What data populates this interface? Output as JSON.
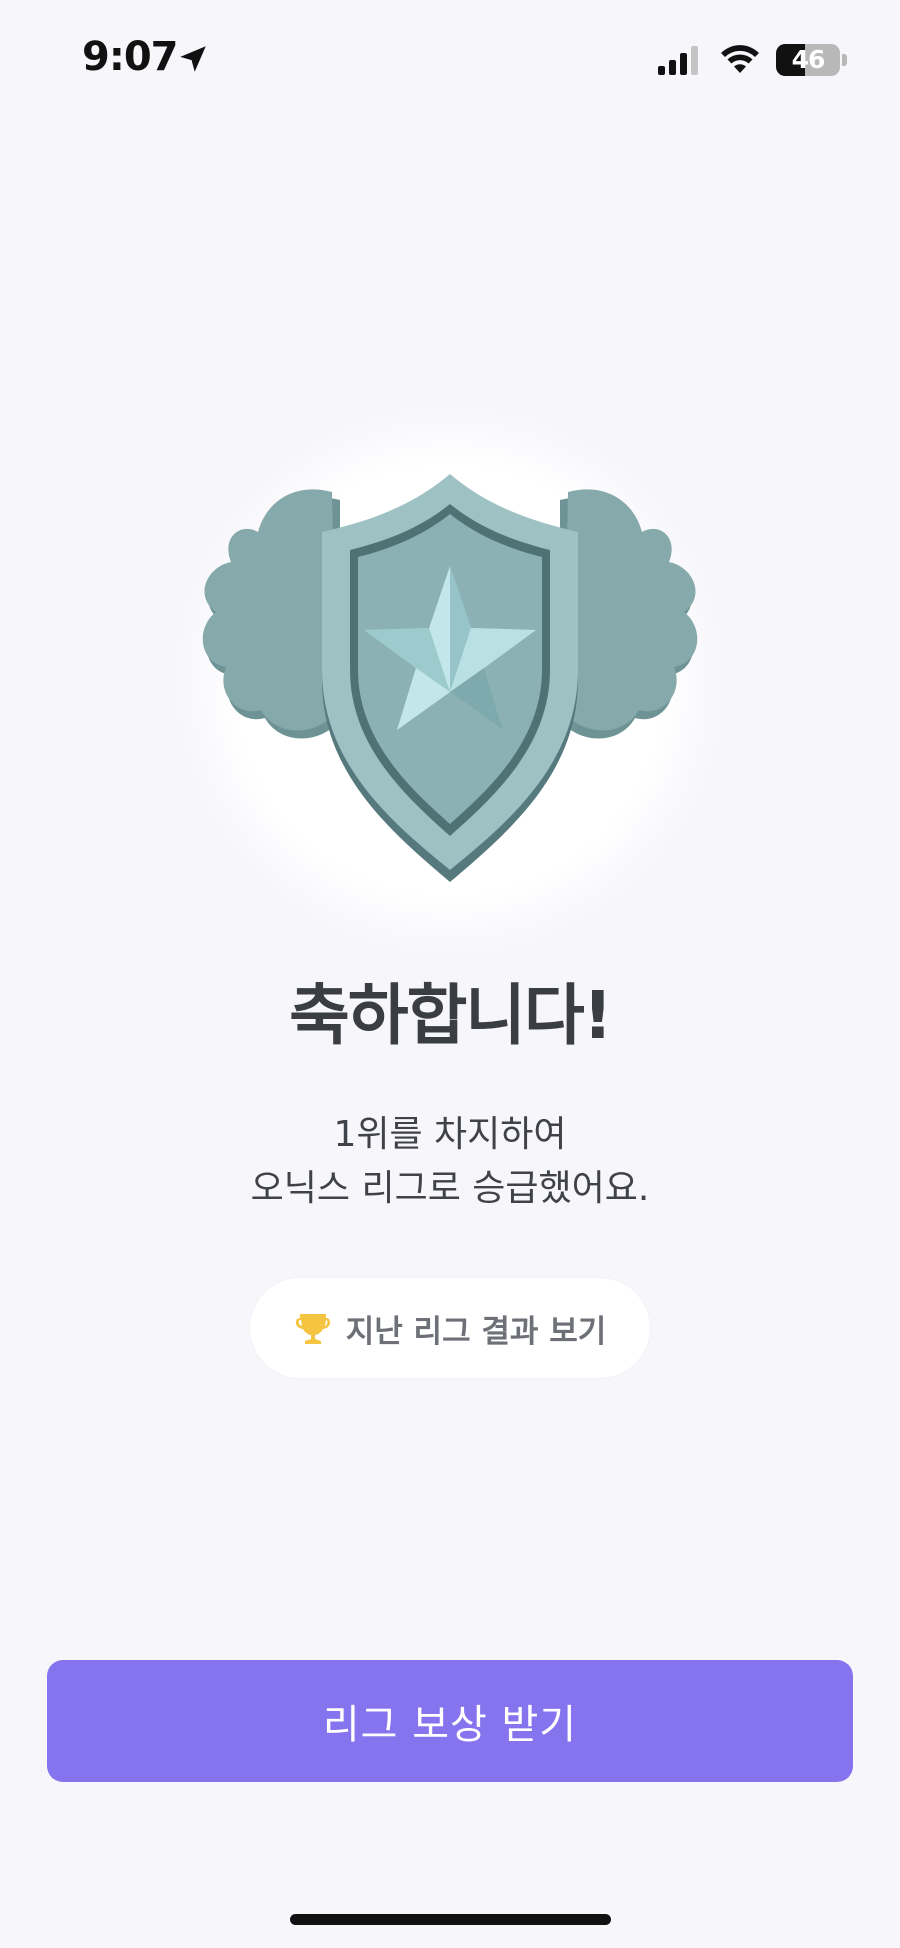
{
  "status_bar": {
    "time": "9:07",
    "battery_percent": "46",
    "battery_level": 0.46,
    "icons": [
      "location-arrow-icon",
      "cellular-signal-icon",
      "wifi-icon",
      "battery-icon"
    ]
  },
  "badge": {
    "icon": "silver-shield-star-badge",
    "colors": {
      "shield": "#89b0b4",
      "shield_dark": "#5f8588",
      "star": "#b2dde1",
      "wings": "#84a7a9"
    }
  },
  "result": {
    "title": "축하합니다!",
    "message_line1": "1위를 차지하여",
    "message_line2": "오닉스 리그로 승급했어요."
  },
  "history_button": {
    "icon": "trophy-icon",
    "label": "지난 리그 결과 보기"
  },
  "claim_button": {
    "label": "리그 보상 받기",
    "color": "#8674ef"
  }
}
